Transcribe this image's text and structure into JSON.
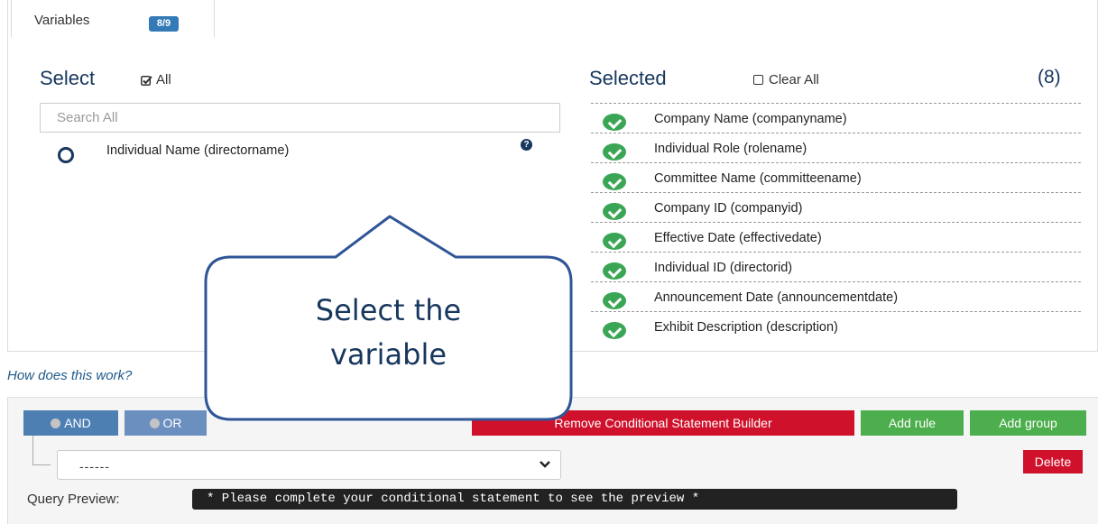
{
  "tab": {
    "label": "Variables",
    "badge": "8/9"
  },
  "select_panel": {
    "heading": "Select",
    "all_label": "All",
    "search_placeholder": "Search All",
    "available_items": [
      {
        "label": "Individual Name (directorname)"
      }
    ]
  },
  "selected_panel": {
    "heading": "Selected",
    "clear_all_label": "Clear All",
    "count": "(8)",
    "items": [
      {
        "label": "Company Name (companyname)"
      },
      {
        "label": "Individual Role (rolename)"
      },
      {
        "label": "Committee Name (committeename)"
      },
      {
        "label": "Company ID (companyid)"
      },
      {
        "label": "Effective Date (effectivedate)"
      },
      {
        "label": "Individual ID (directorid)"
      },
      {
        "label": "Announcement Date (announcementdate)"
      },
      {
        "label": "Exhibit Description (description)"
      }
    ]
  },
  "help_link": "How does this work?",
  "builder": {
    "and_label": "AND",
    "or_label": "OR",
    "remove_label": "Remove Conditional Statement Builder",
    "add_rule_label": "Add rule",
    "add_group_label": "Add group",
    "rule_select_value": "------",
    "delete_label": "Delete"
  },
  "query_preview": {
    "label": "Query Preview:",
    "text": "* Please complete your conditional statement to see the preview *"
  },
  "callout": {
    "line1": "Select the",
    "line2": "variable"
  },
  "colors": {
    "heading_blue": "#17375e",
    "badge_blue": "#337ab7",
    "check_green": "#3aa655",
    "danger_red": "#d0112b",
    "success_green": "#4cae4c"
  }
}
